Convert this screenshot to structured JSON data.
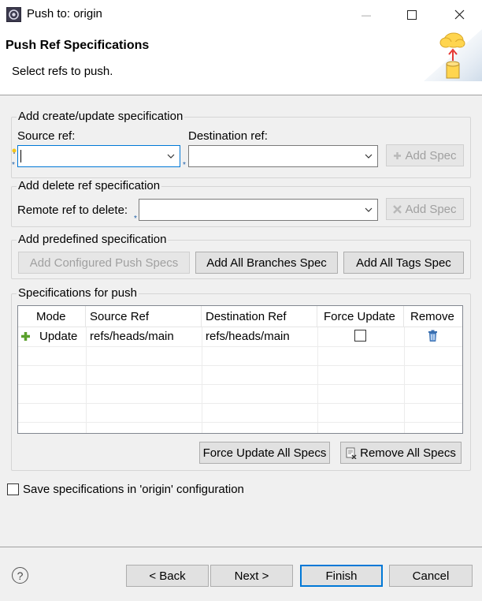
{
  "window": {
    "title": "Push to: origin",
    "minimize_glyph": "—",
    "maximize_glyph": "☐",
    "close_glyph": "✕"
  },
  "header": {
    "title": "Push Ref Specifications",
    "subtitle": "Select refs to push."
  },
  "create_group": {
    "label": "Add create/update specification",
    "source_label": "Source ref:",
    "source_value": "",
    "destination_label": "Destination ref:",
    "destination_value": "",
    "add_spec_label": "Add Spec"
  },
  "delete_group": {
    "label": "Add delete ref specification",
    "remote_label": "Remote ref to delete:",
    "remote_value": "",
    "add_spec_label": "Add Spec"
  },
  "predefined_group": {
    "label": "Add predefined specification",
    "configured_label": "Add Configured Push Specs",
    "branches_label": "Add All Branches Spec",
    "tags_label": "Add All Tags Spec"
  },
  "specs_group": {
    "label": "Specifications for push",
    "columns": [
      "Mode",
      "Source Ref",
      "Destination Ref",
      "Force Update",
      "Remove"
    ],
    "rows": [
      {
        "mode": "Update",
        "source": "refs/heads/main",
        "destination": "refs/heads/main",
        "force": false
      }
    ],
    "force_all_label": "Force Update All Specs",
    "remove_all_label": "Remove All Specs"
  },
  "save_option": {
    "label": "Save specifications in 'origin' configuration",
    "checked": false
  },
  "footer": {
    "help_glyph": "?",
    "back_label": "< Back",
    "next_label": "Next >",
    "finish_label": "Finish",
    "cancel_label": "Cancel"
  },
  "colors": {
    "accent": "#0078d7",
    "background": "#f0f0f0",
    "add_icon": "#5aa02c",
    "trash_icon": "#3a6fb0"
  }
}
